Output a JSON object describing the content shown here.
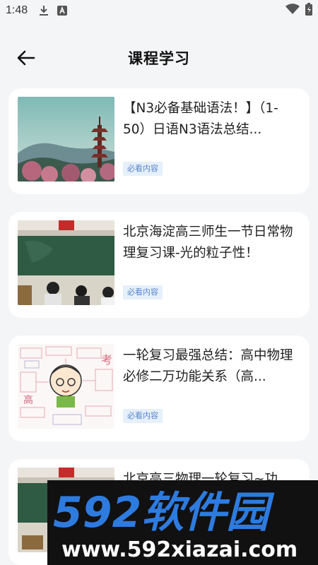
{
  "status_bar": {
    "time": "1:48",
    "icons": [
      "download-icon",
      "a-badge-icon",
      "wifi-icon",
      "battery-icon"
    ]
  },
  "header": {
    "back_icon": "arrow-left-icon",
    "title": "课程学习"
  },
  "courses": [
    {
      "title": "【N3必备基础语法！】（1-50）日语N3语法总结...",
      "badge": "必看内容",
      "thumbnail": "pagoda-landscape"
    },
    {
      "title": "北京海淀高三师生一节日常物理复习课-光的粒子性！",
      "badge": "必看内容",
      "thumbnail": "classroom"
    },
    {
      "title": "一轮复习最强总结：高中物理必修二万功能关系（高...",
      "badge": "必看内容",
      "thumbnail": "mind-map-cartoon"
    },
    {
      "title": "北京高三物理一轮复习~功",
      "badge": "",
      "thumbnail": "classroom"
    }
  ],
  "watermark": {
    "brand": "592软件园",
    "url": "www.592xiazai.com"
  },
  "colors": {
    "background": "#f4f5f7",
    "card": "#ffffff",
    "badge_text": "#5a86c7",
    "badge_bg": "#e6f0fb",
    "watermark_blue": "#2e7be0"
  }
}
